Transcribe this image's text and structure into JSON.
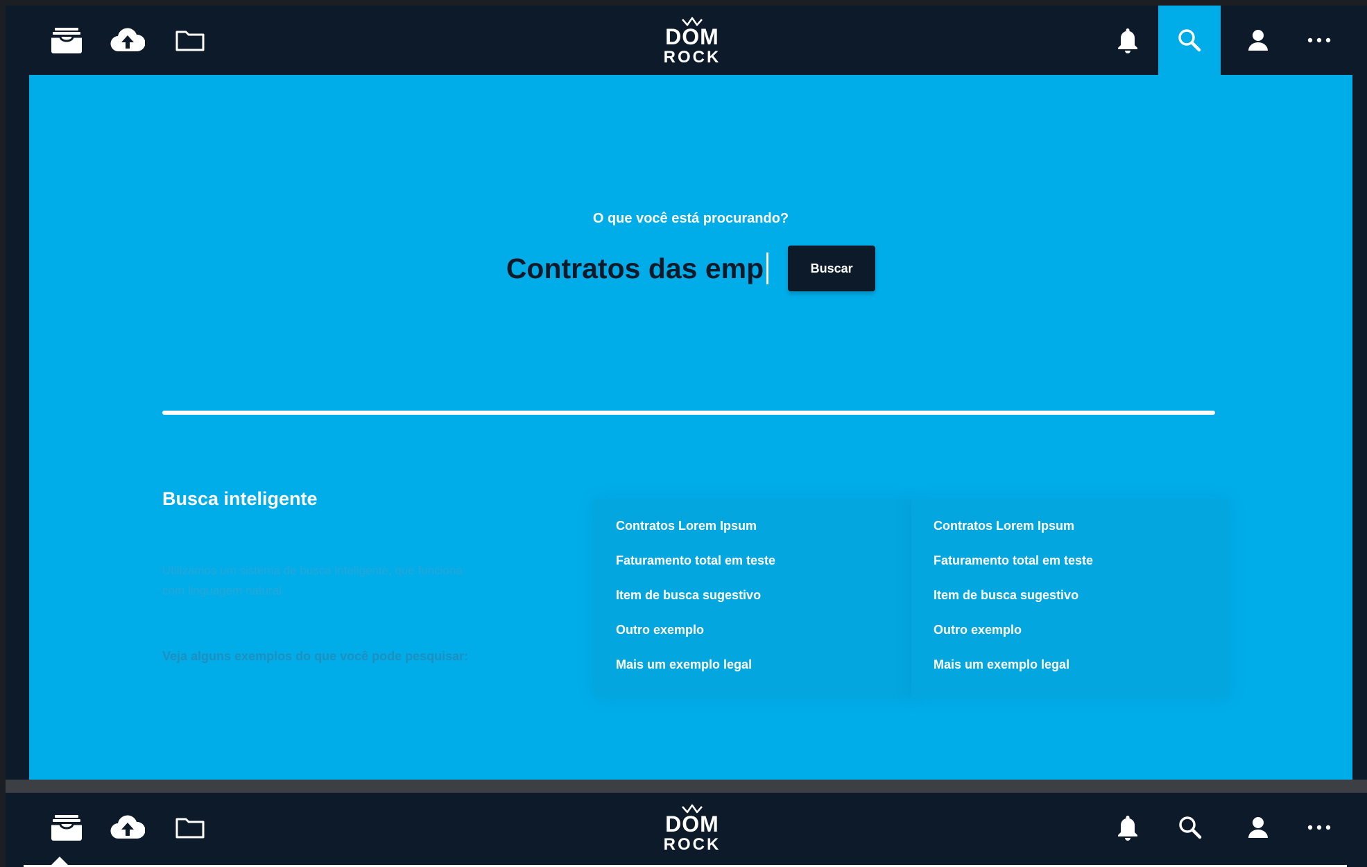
{
  "logo": {
    "line1": "DOM",
    "line2": "ROCK"
  },
  "toolbar": {
    "left_icons": [
      "archive-icon",
      "cloud-upload-icon",
      "folder-icon"
    ],
    "right_icons": [
      "bell-icon",
      "search-icon",
      "user-icon",
      "more-icon"
    ],
    "active": "search-icon"
  },
  "search": {
    "question": "O que você está procurando?",
    "query": "Contratos das emp",
    "button_label": "Buscar"
  },
  "info": {
    "title": "Busca inteligente",
    "description": "Utilizamos um sistema de busca inteligente, que funciona com linguagem natural.",
    "examples_label": "Veja alguns exemplos do que você pode pesquisar:"
  },
  "suggestions": {
    "column1": [
      "Contratos Lorem Ipsum",
      "Faturamento total em teste",
      "Item de busca sugestivo",
      "Outro exemplo",
      "Mais um exemplo legal"
    ],
    "column2": [
      "Contratos Lorem Ipsum",
      "Faturamento total em teste",
      "Item de busca sugestivo",
      "Outro exemplo",
      "Mais um exemplo legal"
    ]
  },
  "colors": {
    "accent": "#01ade9",
    "dark": "#0c1a29",
    "text_light": "#ffffff"
  }
}
